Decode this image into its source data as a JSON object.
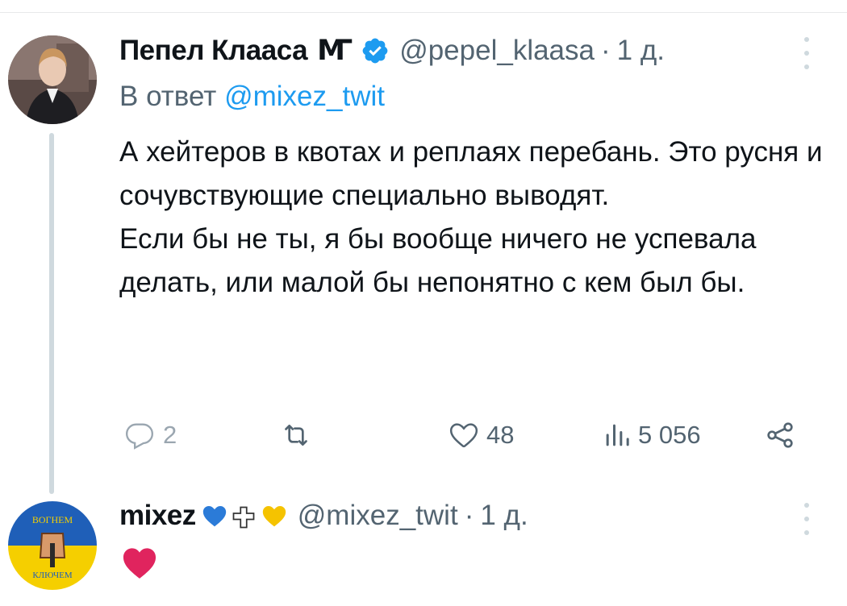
{
  "tweets": [
    {
      "display_name": "Пепел Клааса",
      "name_suffix": "Ꙧ",
      "verified": true,
      "handle": "@pepel_klaasa",
      "separator": "·",
      "time": "1 д.",
      "reply_to_label": "В ответ",
      "reply_to_handle": "@mixez_twit",
      "text_paragraphs": [
        "А хейтеров в квотах и реплаях перебань. Это русня и сочувствующие специально выводят.",
        "Если бы не ты, я бы вообще ничего не успевала делать, или малой бы непонятно с кем был бы."
      ],
      "actions": {
        "replies": "2",
        "retweets": "",
        "likes": "48",
        "views": "5 056"
      }
    },
    {
      "display_name": "mixez",
      "handle": "@mixez_twit",
      "separator": "·",
      "time": "1 д.",
      "text": "❤️",
      "avatar_text_top": "ВОГНЕМ",
      "avatar_text_bottom": "КЛЮЧЕМ"
    }
  ],
  "icons": {
    "verified": "verified-badge-icon",
    "reply": "reply-icon",
    "retweet": "retweet-icon",
    "like": "heart-icon",
    "views": "views-bar-icon",
    "share": "share-icon",
    "more": "more-vertical-icon"
  },
  "colors": {
    "accent": "#1d9bf0",
    "secondary_text": "#536471",
    "divider": "#e7e9ea",
    "thread_line": "#cfd9de",
    "heart_red": "#e0245e",
    "blue_heart": "#2b7bd8",
    "yellow_heart": "#f5c300"
  }
}
